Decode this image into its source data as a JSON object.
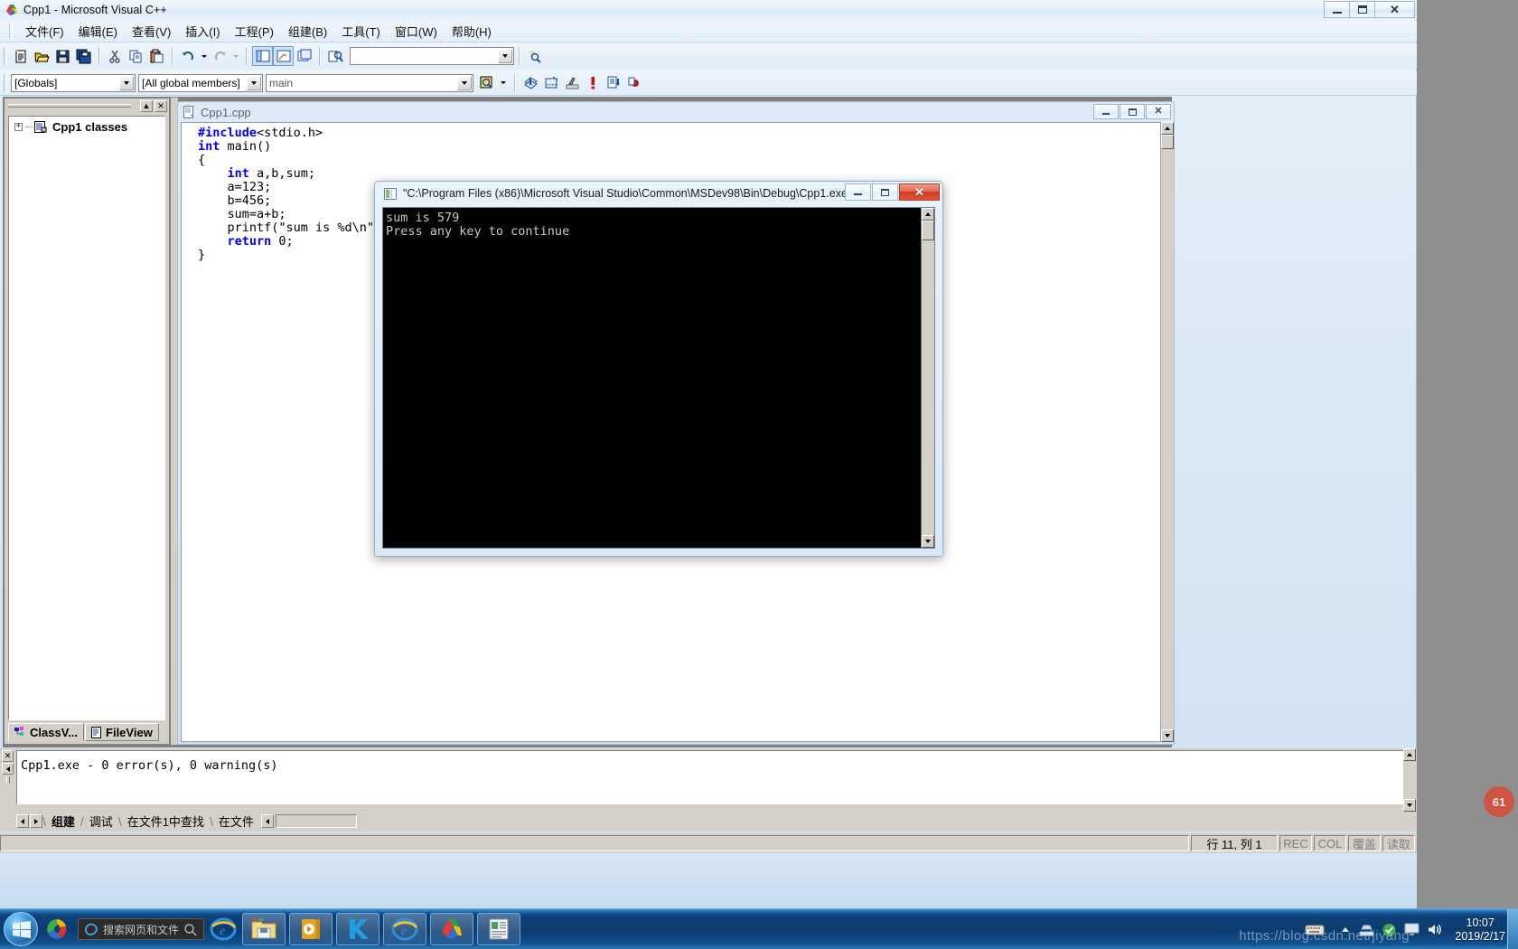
{
  "window": {
    "title": "Cpp1 - Microsoft Visual C++",
    "icon": "vcpp-icon",
    "buttons": {
      "minimize": "–",
      "maximize": "❐",
      "close": "✕"
    }
  },
  "menubar": {
    "items": [
      {
        "label": "文件(F)",
        "name": "menu-file"
      },
      {
        "label": "编辑(E)",
        "name": "menu-edit"
      },
      {
        "label": "查看(V)",
        "name": "menu-view"
      },
      {
        "label": "插入(I)",
        "name": "menu-insert"
      },
      {
        "label": "工程(P)",
        "name": "menu-project"
      },
      {
        "label": "组建(B)",
        "name": "menu-build"
      },
      {
        "label": "工具(T)",
        "name": "menu-tools"
      },
      {
        "label": "窗口(W)",
        "name": "menu-window"
      },
      {
        "label": "帮助(H)",
        "name": "menu-help"
      }
    ]
  },
  "toolbar_standard": {
    "buttons": [
      "new-file-icon",
      "open-file-icon",
      "save-icon",
      "save-all-icon",
      "cut-icon",
      "copy-icon",
      "paste-icon",
      "undo-icon",
      "undo-dropdown-icon",
      "redo-icon",
      "redo-dropdown-icon",
      "workspace-toggle-icon",
      "output-toggle-icon",
      "window-list-icon",
      "find-in-files-icon"
    ],
    "search_box": {
      "value": "",
      "placeholder": ""
    },
    "help_button": "search-help-icon"
  },
  "toolbar_wizardbar": {
    "class_combo": {
      "value": "[Globals]"
    },
    "filter_combo": {
      "value": "[All global members]"
    },
    "member_combo": {
      "value": "main"
    },
    "action_button": "wizardbar-action-icon",
    "buttons": [
      "compile-icon",
      "build-icon",
      "stop-build-icon",
      "execute-icon",
      "go-icon",
      "insert-breakpoint-icon"
    ]
  },
  "workspace": {
    "caption_buttons": {
      "restore": "▲",
      "close": "✕"
    },
    "tree": {
      "root": {
        "label": "Cpp1 classes",
        "expander": "+",
        "icon": "class-folder-icon"
      }
    },
    "tabs": [
      {
        "label": "ClassV...",
        "name": "tab-classview",
        "icon": "classview-icon",
        "active": true
      },
      {
        "label": "FileView",
        "name": "tab-fileview",
        "icon": "fileview-icon",
        "active": false
      }
    ]
  },
  "editor": {
    "title": "Cpp1.cpp",
    "icon": "cpp-source-icon",
    "buttons": {
      "minimize": "–",
      "maximize": "❐",
      "close": "✕"
    },
    "code_lines": [
      {
        "segments": [
          {
            "t": "#include",
            "c": "pp"
          },
          {
            "t": "<stdio.h>",
            "c": ""
          }
        ]
      },
      {
        "segments": [
          {
            "t": "int",
            "c": "kw"
          },
          {
            "t": " main()",
            "c": ""
          }
        ]
      },
      {
        "segments": [
          {
            "t": "{",
            "c": ""
          }
        ]
      },
      {
        "segments": [
          {
            "t": "    ",
            "c": ""
          },
          {
            "t": "int",
            "c": "kw"
          },
          {
            "t": " a,b,sum;",
            "c": ""
          }
        ]
      },
      {
        "segments": [
          {
            "t": "    a=123;",
            "c": ""
          }
        ]
      },
      {
        "segments": [
          {
            "t": "    b=456;",
            "c": ""
          }
        ]
      },
      {
        "segments": [
          {
            "t": "    sum=a+b;",
            "c": ""
          }
        ]
      },
      {
        "segments": [
          {
            "t": "    printf(\"sum is %d\\n\",sum);",
            "c": ""
          }
        ]
      },
      {
        "segments": [
          {
            "t": "    ",
            "c": ""
          },
          {
            "t": "return",
            "c": "kw"
          },
          {
            "t": " 0;",
            "c": ""
          }
        ]
      },
      {
        "segments": [
          {
            "t": "}",
            "c": ""
          }
        ]
      }
    ]
  },
  "console": {
    "title": "\"C:\\Program Files (x86)\\Microsoft Visual Studio\\Common\\MSDev98\\Bin\\Debug\\Cpp1.exe\"",
    "icon": "console-icon",
    "buttons": {
      "minimize": "–",
      "maximize": "❐",
      "close": "✕"
    },
    "lines": [
      "sum is 579",
      "Press any key to continue"
    ],
    "output_text": "sum is 579\nPress any key to continue"
  },
  "output_pane": {
    "text": "Cpp1.exe - 0 error(s), 0 warning(s)",
    "close_button": "✕",
    "tabs": [
      {
        "label": "组建",
        "name": "output-tab-build",
        "active": true
      },
      {
        "label": "调试",
        "name": "output-tab-debug",
        "active": false
      },
      {
        "label": "在文件1中查找",
        "name": "output-tab-findinfiles1",
        "active": false
      },
      {
        "label": "在文件",
        "name": "output-tab-findinfiles2",
        "active": false
      }
    ]
  },
  "statusbar": {
    "message": "",
    "position": "行 11, 列 1",
    "indicators": [
      {
        "label": "REC",
        "dim": true
      },
      {
        "label": "COL",
        "dim": true
      },
      {
        "label": "覆盖",
        "dim": true
      },
      {
        "label": "读取",
        "dim": true
      }
    ]
  },
  "taskbar": {
    "start": "start-orb-icon",
    "quick_launch": [
      {
        "name": "sogou-input-icon"
      }
    ],
    "search": {
      "placeholder": "搜索网页和文件",
      "value": "",
      "icon": "edge-search-icon",
      "magnifier": "search-icon"
    },
    "apps": [
      {
        "name": "taskbar-internet-explorer",
        "icon": "ie-icon"
      },
      {
        "name": "taskbar-file-explorer",
        "icon": "folder-icon"
      },
      {
        "name": "taskbar-media-player",
        "icon": "media-player-icon"
      },
      {
        "name": "taskbar-kugou",
        "icon": "kugou-icon"
      },
      {
        "name": "taskbar-ie-window",
        "icon": "ie-icon"
      },
      {
        "name": "taskbar-visual-cpp",
        "icon": "vcpp-icon"
      },
      {
        "name": "taskbar-document-window",
        "icon": "document-icon"
      }
    ],
    "tray": {
      "icons": [
        "keyboard-icon",
        "show-hidden-icon",
        "network-icon",
        "security-icon",
        "display-icon",
        "volume-icon"
      ],
      "time": "10:07",
      "date": "2019/2/17"
    }
  },
  "watermark": {
    "text": "https://blog.csdn.net/jiyang"
  },
  "colors": {
    "keyword": "#0000ff",
    "console_bg": "#000000",
    "console_fg": "#c8c8c8",
    "chrome": "#d4d0c8",
    "taskbar": "#0e4279",
    "close_button": "#cf3a20"
  }
}
